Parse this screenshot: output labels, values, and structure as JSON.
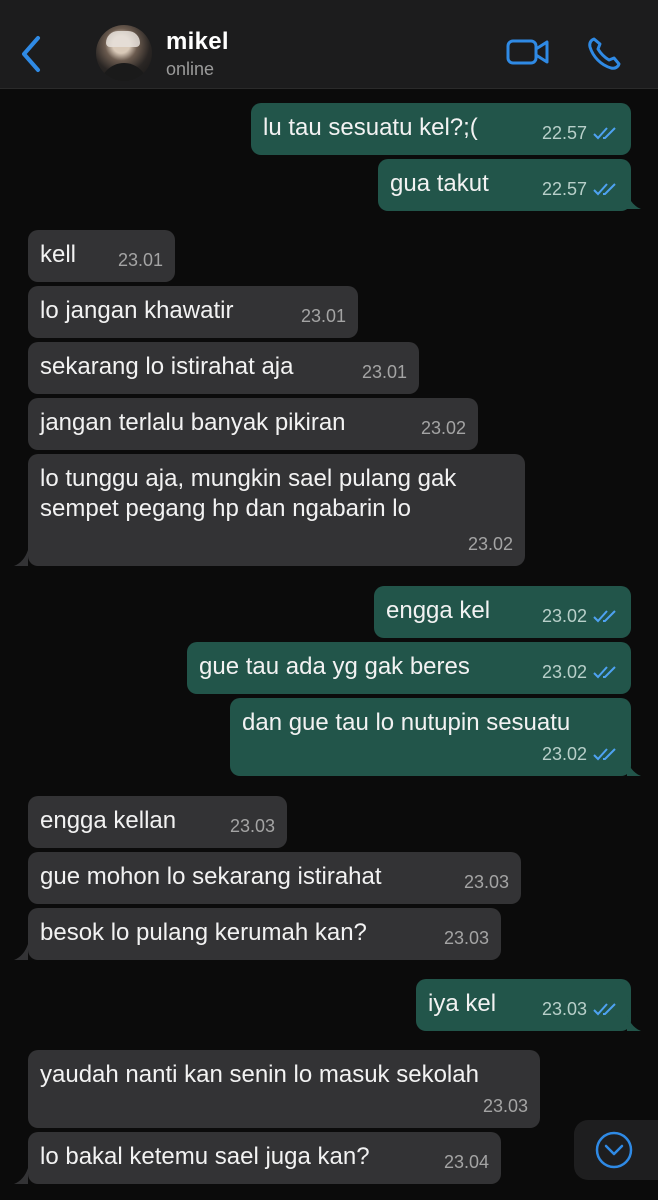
{
  "header": {
    "contact_name": "mikel",
    "contact_status": "online",
    "icons": {
      "back": "chevron-left-icon",
      "video": "video-camera-icon",
      "phone": "phone-icon"
    }
  },
  "colors": {
    "accent": "#2f8ae5",
    "incoming_bubble": "#333335",
    "outgoing_bubble": "#22554a",
    "background": "#0b0b0b"
  },
  "messages": [
    {
      "dir": "out",
      "text": "lu tau sesuatu kel?;(",
      "time": "22.57",
      "read": true
    },
    {
      "dir": "out",
      "text": "gua takut",
      "time": "22.57",
      "read": true
    },
    {
      "dir": "in",
      "text": "kell",
      "time": "23.01"
    },
    {
      "dir": "in",
      "text": "lo jangan khawatir",
      "time": "23.01"
    },
    {
      "dir": "in",
      "text": "sekarang lo istirahat aja",
      "time": "23.01"
    },
    {
      "dir": "in",
      "text": "jangan terlalu banyak pikiran",
      "time": "23.02"
    },
    {
      "dir": "in",
      "text_lines": [
        "lo tunggu aja, mungkin sael pulang gak",
        "sempet pegang hp dan ngabarin lo"
      ],
      "time": "23.02"
    },
    {
      "dir": "out",
      "text": "engga kel",
      "time": "23.02",
      "read": true
    },
    {
      "dir": "out",
      "text": "gue tau ada yg gak beres",
      "time": "23.02",
      "read": true
    },
    {
      "dir": "out",
      "text": "dan gue tau lo nutupin sesuatu",
      "time": "23.02",
      "read": true
    },
    {
      "dir": "in",
      "text": "engga kellan",
      "time": "23.03"
    },
    {
      "dir": "in",
      "text": "gue mohon lo sekarang istirahat",
      "time": "23.03"
    },
    {
      "dir": "in",
      "text": "besok lo pulang kerumah kan?",
      "time": "23.03"
    },
    {
      "dir": "out",
      "text": "iya kel",
      "time": "23.03",
      "read": true
    },
    {
      "dir": "in",
      "text": "yaudah nanti kan senin lo masuk sekolah",
      "time": "23.03"
    },
    {
      "dir": "in",
      "text": "lo bakal ketemu sael juga kan?",
      "time": "23.04"
    }
  ],
  "scroll_button": {
    "icon": "chevron-down-circle-icon"
  }
}
